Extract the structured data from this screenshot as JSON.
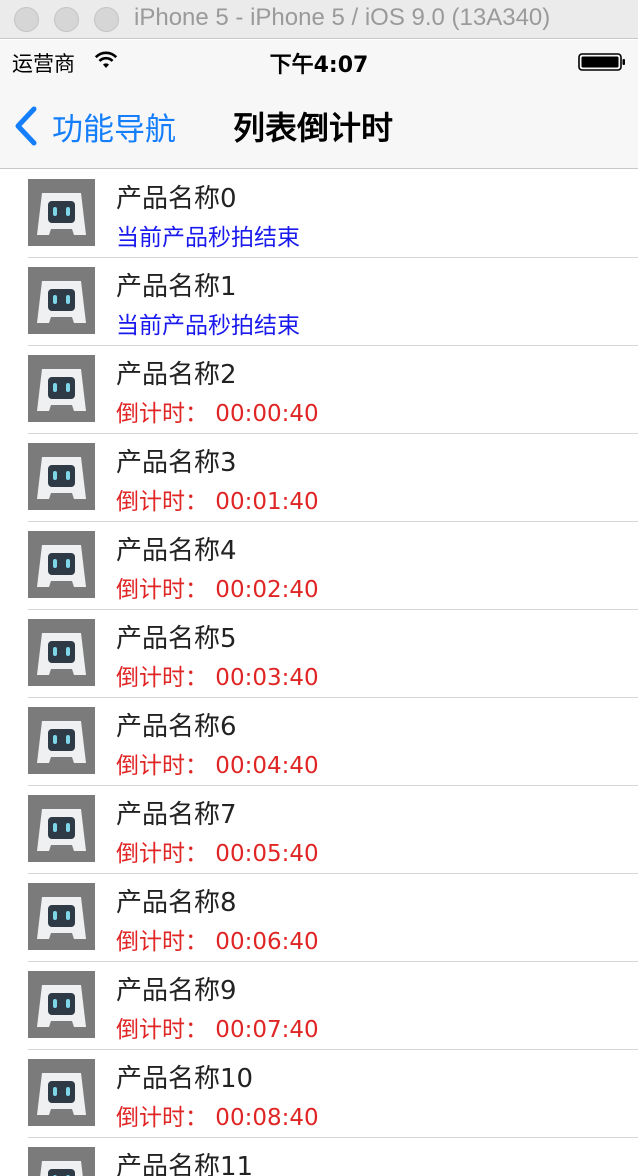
{
  "window": {
    "title": "iPhone 5 - iPhone 5 / iOS 9.0 (13A340)"
  },
  "status_bar": {
    "carrier": "运营商",
    "time": "下午4:07"
  },
  "nav": {
    "back_label": "功能导航",
    "title": "列表倒计时"
  },
  "colors": {
    "accent": "#157efb",
    "ended_text": "#1a1aee",
    "countdown_text": "#e02525"
  },
  "icons": {
    "app_thumbnail": "cordova-robot-icon"
  },
  "products": [
    {
      "name": "产品名称0",
      "status": "当前产品秒拍结束",
      "kind": "ended"
    },
    {
      "name": "产品名称1",
      "status": "当前产品秒拍结束",
      "kind": "ended"
    },
    {
      "name": "产品名称2",
      "status": "倒计时：  00:00:40",
      "kind": "countdown"
    },
    {
      "name": "产品名称3",
      "status": "倒计时：  00:01:40",
      "kind": "countdown"
    },
    {
      "name": "产品名称4",
      "status": "倒计时：  00:02:40",
      "kind": "countdown"
    },
    {
      "name": "产品名称5",
      "status": "倒计时：  00:03:40",
      "kind": "countdown"
    },
    {
      "name": "产品名称6",
      "status": "倒计时：  00:04:40",
      "kind": "countdown"
    },
    {
      "name": "产品名称7",
      "status": "倒计时：  00:05:40",
      "kind": "countdown"
    },
    {
      "name": "产品名称8",
      "status": "倒计时：  00:06:40",
      "kind": "countdown"
    },
    {
      "name": "产品名称9",
      "status": "倒计时：  00:07:40",
      "kind": "countdown"
    },
    {
      "name": "产品名称10",
      "status": "倒计时：  00:08:40",
      "kind": "countdown"
    },
    {
      "name": "产品名称11",
      "status": "",
      "kind": "countdown"
    }
  ]
}
